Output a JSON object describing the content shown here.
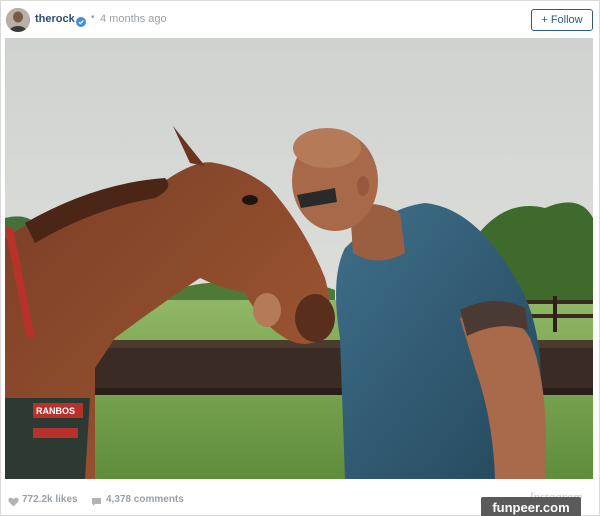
{
  "post": {
    "username": "therock",
    "separator": "•",
    "time_ago": "4 months ago",
    "follow_label": "Follow",
    "follow_plus": "+",
    "likes": "772.2k likes",
    "comments": "4,378 comments",
    "platform_mark": "Instagram",
    "blanket_text": "RANBOS"
  },
  "watermark": {
    "text": "funpeer.com"
  },
  "colors": {
    "username": "#2b4f6e",
    "verified": "#3d8fd6",
    "follow_border": "#2f5b7d",
    "meta_gray": "#9aa0a6"
  },
  "icons": {
    "verified": "verified-badge-icon",
    "likes": "heart-icon",
    "comments": "speech-bubble-icon"
  }
}
